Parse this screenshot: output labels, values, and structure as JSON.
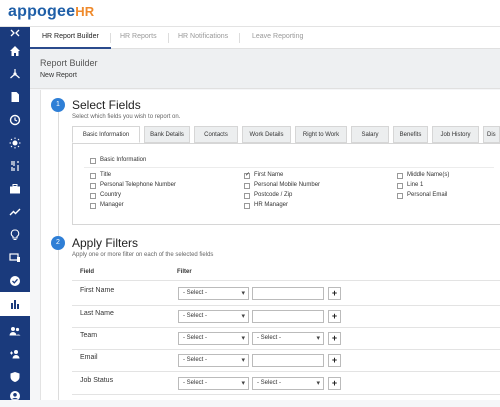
{
  "brand": {
    "part1": "appogee",
    "part2": "HR"
  },
  "top_tabs": [
    {
      "label": "HR Report Builder"
    },
    {
      "label": "HR Reports"
    },
    {
      "label": "HR Notifications"
    },
    {
      "label": "Leave Reporting"
    }
  ],
  "breadcrumb": "Report Builder",
  "page_subtitle": "New Report",
  "step1": {
    "number": "1",
    "title": "Select Fields",
    "description": "Select which fields you wish to report on.",
    "tabs": [
      "Basic Information",
      "Bank Details",
      "Contacts",
      "Work Details",
      "Right to Work",
      "Salary",
      "Benefits",
      "Job History",
      "Dis"
    ],
    "group_label": "Basic Information",
    "fields": [
      {
        "label": "Title",
        "checked": false
      },
      {
        "label": "Personal Telephone Number",
        "checked": false
      },
      {
        "label": "Country",
        "checked": false
      },
      {
        "label": "Manager",
        "checked": false
      },
      {
        "label": "First Name",
        "checked": true
      },
      {
        "label": "Personal Mobile Number",
        "checked": false
      },
      {
        "label": "Postcode / Zip",
        "checked": false
      },
      {
        "label": "HR Manager",
        "checked": false
      },
      {
        "label": "Middle Name(s)",
        "checked": false
      },
      {
        "label": "Line 1",
        "checked": false
      },
      {
        "label": "Personal Email",
        "checked": false
      }
    ]
  },
  "step2": {
    "number": "2",
    "title": "Apply Filters",
    "description": "Apply one or more filter on each of the selected fields",
    "col_field": "Field",
    "col_filter": "Filter",
    "select_placeholder": "- Select -",
    "rows": [
      {
        "field": "First Name",
        "type": "text"
      },
      {
        "field": "Last Name",
        "type": "text"
      },
      {
        "field": "Team",
        "type": "double"
      },
      {
        "field": "Email",
        "type": "text"
      },
      {
        "field": "Job Status",
        "type": "double"
      }
    ]
  },
  "sidebar_icons": [
    "expand-icon",
    "home-icon",
    "org-chart-icon",
    "document-icon",
    "clock-icon",
    "sun-icon",
    "filter-icon",
    "briefcase-icon",
    "trending-icon",
    "lightbulb-icon",
    "devices-icon",
    "check-circle-icon",
    "reports-icon",
    "people-icon",
    "add-person-icon",
    "shield-icon",
    "account-icon"
  ],
  "colors": {
    "sidebar": "#1a3a7c",
    "accent": "#2f7fd6",
    "logo_blue": "#1f5fa8",
    "logo_orange": "#ef8a2c"
  }
}
